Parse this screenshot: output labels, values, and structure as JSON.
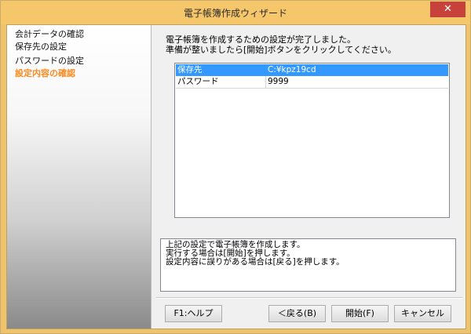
{
  "window": {
    "title": "電子帳簿作成ウィザード",
    "close_label": "✕"
  },
  "sidebar": {
    "items": [
      {
        "label": "会計データの確認",
        "active": false
      },
      {
        "label": "保存先の設定",
        "active": false
      },
      {
        "label": "パスワードの設定",
        "active": false
      },
      {
        "label": "設定内容の確認",
        "active": true
      }
    ]
  },
  "message": {
    "line1": "電子帳簿を作成するための設定が完了しました。",
    "line2": "準備が整いましたら[開始]ボタンをクリックしてください。"
  },
  "settings_list": {
    "rows": [
      {
        "name": "保存先",
        "value": "C:¥kpz19cd",
        "selected": true
      },
      {
        "name": "パスワード",
        "value": "9999",
        "selected": false
      }
    ]
  },
  "description": {
    "lines": [
      "上記の設定で電子帳簿を作成します。",
      "実行する場合は[開始]を押します。",
      "設定内容に誤りがある場合は[戻る]を押します。"
    ]
  },
  "buttons": {
    "help": "F1:ヘルプ",
    "back": "＜戻る(B)",
    "start": "開始(F)",
    "cancel": "キャンセル"
  },
  "colors": {
    "title_bar": "#f5c66a",
    "selection": "#3399ff",
    "active_step": "#ff8a1f",
    "close_button": "#c7423a"
  }
}
